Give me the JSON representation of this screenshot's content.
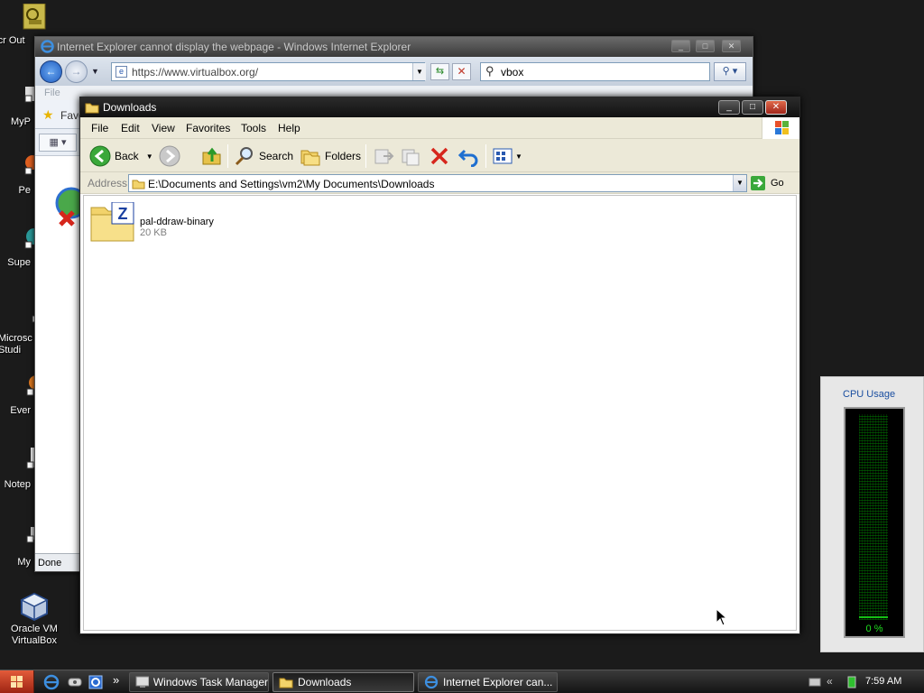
{
  "desktop": {
    "icons": [
      {
        "label": "Micr Out"
      },
      {
        "label": "MyP"
      },
      {
        "label": "Pe"
      },
      {
        "label": "Supe"
      },
      {
        "label": "Microsc Studi"
      },
      {
        "label": "Ever"
      },
      {
        "label": "Notep"
      },
      {
        "label": "My"
      },
      {
        "label": "Oracle VM VirtualBox"
      }
    ]
  },
  "ie_window": {
    "title": "Internet Explorer cannot display the webpage - Windows Internet Explorer",
    "url": "https://www.virtualbox.org/",
    "search_value": "vbox",
    "menu": "File",
    "favorites_label": "Favo",
    "status": "Done"
  },
  "explorer": {
    "title": "Downloads",
    "menu": [
      "File",
      "Edit",
      "View",
      "Favorites",
      "Tools",
      "Help"
    ],
    "toolbar": {
      "back": "Back",
      "search": "Search",
      "folders": "Folders"
    },
    "address_label": "Address",
    "address": "E:\\Documents and Settings\\vm2\\My Documents\\Downloads",
    "go_label": "Go",
    "files": [
      {
        "name": "pal-ddraw-binary",
        "size": "20 KB"
      }
    ]
  },
  "cpu_gadget": {
    "title": "CPU Usage",
    "percent": "0 %",
    "usage_fraction": 0
  },
  "taskbar": {
    "tasks": [
      {
        "label": "Windows Task Manager"
      },
      {
        "label": "Downloads"
      },
      {
        "label": "Internet Explorer can..."
      }
    ],
    "overflow": "»",
    "tray_chevron": "«",
    "clock": "7:59 AM"
  },
  "colors": {
    "accent_blue": "#1a4ea0",
    "close_red": "#c0392b",
    "cpu_green": "#1fe01f"
  }
}
